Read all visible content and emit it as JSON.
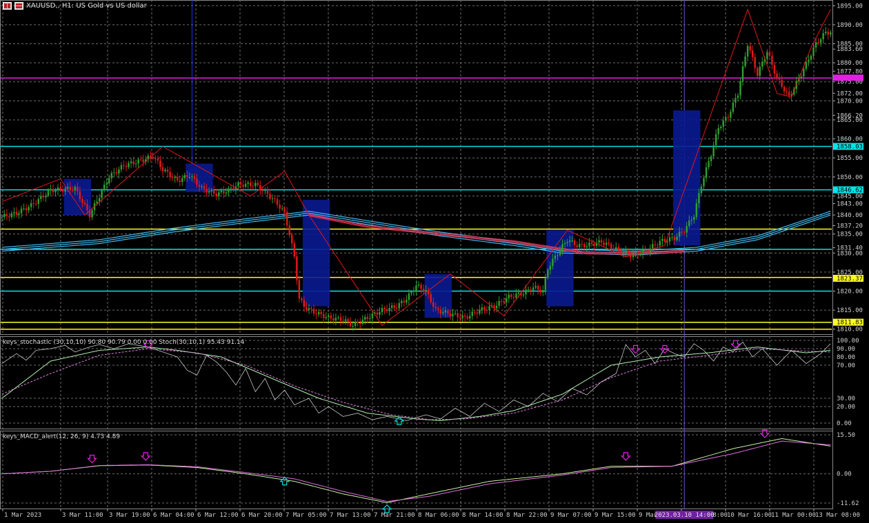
{
  "window": {
    "title": "XAUUSD,, H1:  US Gold vs US dollar"
  },
  "panes": {
    "stoch_label": "keys_stochastic (30,10,10) 90.80 90.79 0.00 0.00 Stoch(30,10,1) 95.43 91.14",
    "macd_label": "keys_MACD_alert(12, 26, 9) 4.73 4.89"
  },
  "colors": {
    "background": "#000000",
    "grid": "#6e6e6e",
    "bull": "#2e9e2e",
    "bear": "#e01818",
    "box": "#0a1a90",
    "zigzag": "#e01818",
    "ma_blue": "#40b8f0",
    "ma_red": "#e03050",
    "cyan_line": "#00e5e5",
    "yellow_line": "#ffff20",
    "magenta_line": "#e020e0",
    "vline_blue": "#2030ff",
    "vline_violet": "#7050d0"
  },
  "chart_data": [
    {
      "type": "candlestick",
      "symbol": "XAUUSD",
      "timeframe": "H1",
      "y_axis_labels": [
        "1895.00",
        "1890.00",
        "1885.00",
        "1883.60",
        "1880.00",
        "1877.80",
        "1875.00",
        "1872.00",
        "1870.00",
        "1866.20",
        "1865.00",
        "1860.00",
        "1858.03",
        "1855.00",
        "1850.00",
        "1846.62",
        "1845.00",
        "1843.00",
        "1840.00",
        "1837.20",
        "1835.00",
        "1831.40",
        "1830.00",
        "1825.00",
        "1823.37",
        "1820.00",
        "1815.00",
        "1811.83",
        "1810.00"
      ],
      "y_range": [
        1808.5,
        1896.5
      ],
      "x_tick_labels": [
        "1 Mar 2023",
        "3 Mar 11:00",
        "3 Mar 19:00",
        "6 Mar 04:00",
        "6 Mar 12:00",
        "6 Mar 20:00",
        "7 Mar 05:00",
        "7 Mar 13:00",
        "7 Mar 21:00",
        "8 Mar 06:00",
        "8 Mar 14:00",
        "8 Mar 22:00",
        "9 Mar 07:00",
        "9 Mar 15:00",
        "9 Mar 23:00",
        "10 Mar 08:00",
        "10 Mar 16:00",
        "11 Mar 00:00",
        "13 Mar 08:00"
      ],
      "crosshair_time_label": "2023.03.10 14:00",
      "anchors": [
        [
          0,
          1839.5
        ],
        [
          6,
          1840.5
        ],
        [
          12,
          1842.5
        ],
        [
          20,
          1846.5
        ],
        [
          30,
          1847
        ],
        [
          36,
          1840
        ],
        [
          44,
          1850
        ],
        [
          50,
          1853
        ],
        [
          58,
          1854.5
        ],
        [
          62,
          1855.5
        ],
        [
          66,
          1852
        ],
        [
          72,
          1849
        ],
        [
          77,
          1850.5
        ],
        [
          82,
          1847
        ],
        [
          88,
          1845.5
        ],
        [
          93,
          1846.5
        ],
        [
          97,
          1848
        ],
        [
          104,
          1848
        ],
        [
          109,
          1845.5
        ],
        [
          113,
          1843
        ],
        [
          116,
          1840.5
        ],
        [
          118,
          1835
        ],
        [
          120,
          1829
        ],
        [
          122,
          1818
        ],
        [
          124,
          1816
        ],
        [
          128,
          1814.5
        ],
        [
          134,
          1813
        ],
        [
          140,
          1812.5
        ],
        [
          144,
          1811
        ],
        [
          150,
          1813
        ],
        [
          156,
          1815
        ],
        [
          162,
          1816
        ],
        [
          166,
          1818
        ],
        [
          170,
          1821.5
        ],
        [
          174,
          1820
        ],
        [
          178,
          1815
        ],
        [
          184,
          1814
        ],
        [
          190,
          1813
        ],
        [
          196,
          1815
        ],
        [
          202,
          1816
        ],
        [
          208,
          1818.5
        ],
        [
          214,
          1819.5
        ],
        [
          218,
          1821
        ],
        [
          222,
          1820
        ],
        [
          224,
          1826
        ],
        [
          228,
          1830
        ],
        [
          232,
          1833.5
        ],
        [
          236,
          1832
        ],
        [
          240,
          1832
        ],
        [
          246,
          1833
        ],
        [
          252,
          1831
        ],
        [
          258,
          1829.5
        ],
        [
          264,
          1830.5
        ],
        [
          270,
          1833
        ],
        [
          276,
          1834
        ],
        [
          280,
          1836
        ],
        [
          284,
          1840
        ],
        [
          287,
          1848
        ],
        [
          291,
          1856
        ],
        [
          294,
          1863
        ],
        [
          298,
          1866
        ],
        [
          302,
          1872
        ],
        [
          306,
          1885
        ],
        [
          310,
          1877
        ],
        [
          314,
          1883
        ],
        [
          318,
          1876
        ],
        [
          323,
          1871
        ],
        [
          328,
          1877
        ],
        [
          334,
          1885
        ],
        [
          338,
          1888
        ]
      ],
      "blue_boxes": [
        {
          "from": 26,
          "to": 36,
          "low": 1840,
          "high": 1849.5
        },
        {
          "from": 76,
          "to": 86,
          "low": 1846,
          "high": 1853.5
        },
        {
          "from": 124,
          "to": 134,
          "low": 1816,
          "high": 1844
        },
        {
          "from": 174,
          "to": 184,
          "low": 1813,
          "high": 1824.5
        },
        {
          "from": 224,
          "to": 234,
          "low": 1816,
          "high": 1836
        },
        {
          "from": 276,
          "to": 286,
          "low": 1832,
          "high": 1867.5
        }
      ],
      "zigzag": [
        [
          0,
          1843.5
        ],
        [
          24,
          1849.5
        ],
        [
          34,
          1840
        ],
        [
          66,
          1858
        ],
        [
          102,
          1845
        ],
        [
          116,
          1851.5
        ],
        [
          126,
          1840
        ],
        [
          156,
          1811
        ],
        [
          184,
          1824.5
        ],
        [
          206,
          1813.5
        ],
        [
          232,
          1836
        ],
        [
          256,
          1829
        ],
        [
          272,
          1832
        ],
        [
          306,
          1894
        ],
        [
          318,
          1872
        ],
        [
          324,
          1871
        ],
        [
          332,
          1884
        ],
        [
          340,
          1894
        ]
      ],
      "ma_blue": [
        [
          0,
          1831
        ],
        [
          40,
          1833
        ],
        [
          70,
          1836
        ],
        [
          100,
          1838.5
        ],
        [
          126,
          1840.5
        ],
        [
          150,
          1838
        ],
        [
          180,
          1835
        ],
        [
          210,
          1832.5
        ],
        [
          230,
          1830.5
        ],
        [
          260,
          1830
        ],
        [
          285,
          1831
        ],
        [
          310,
          1834
        ],
        [
          340,
          1840.5
        ]
      ],
      "ma_red": [
        [
          126,
          1840
        ],
        [
          150,
          1837
        ],
        [
          180,
          1835
        ],
        [
          210,
          1833
        ],
        [
          240,
          1830
        ],
        [
          260,
          1830
        ],
        [
          280,
          1830.5
        ]
      ],
      "horizontal_lines": [
        {
          "price": 1876,
          "color": "magenta"
        },
        {
          "price": 1858.03,
          "color": "cyan"
        },
        {
          "price": 1846.62,
          "color": "cyan"
        },
        {
          "price": 1831,
          "color": "cyan"
        },
        {
          "price": 1820,
          "color": "cyan"
        },
        {
          "price": 1836.3,
          "color": "yellow"
        },
        {
          "price": 1823.6,
          "color": "yellow"
        },
        {
          "price": 1811.8,
          "color": "yellow"
        },
        {
          "price": 1810,
          "color": "yellow"
        }
      ],
      "price_tags": [
        {
          "label": "1858.03",
          "price": 1858.03,
          "color": "cyan"
        },
        {
          "label": "1846.62",
          "price": 1846.62,
          "color": "cyan"
        },
        {
          "label": "1823.37",
          "price": 1823.37,
          "color": "yellow"
        },
        {
          "label": "1811.83",
          "price": 1811.83,
          "color": "yellow"
        }
      ],
      "vertical_lines": [
        {
          "index": 78,
          "color": "blue"
        },
        {
          "index": 280,
          "color": "violet"
        }
      ]
    },
    {
      "type": "line",
      "name": "keys_stochastic",
      "y_axis_labels": [
        "100.00",
        "90.00",
        "80.00",
        "70.00",
        "30.00",
        "20.00",
        "0.00"
      ],
      "y_range": [
        0,
        100
      ],
      "main": [
        [
          0,
          30
        ],
        [
          20,
          75
        ],
        [
          40,
          88
        ],
        [
          60,
          92
        ],
        [
          72,
          88
        ],
        [
          90,
          80
        ],
        [
          110,
          55
        ],
        [
          130,
          30
        ],
        [
          150,
          12
        ],
        [
          170,
          5
        ],
        [
          180,
          3
        ],
        [
          196,
          8
        ],
        [
          210,
          15
        ],
        [
          230,
          35
        ],
        [
          250,
          70
        ],
        [
          270,
          80
        ],
        [
          290,
          85
        ],
        [
          310,
          92
        ],
        [
          330,
          85
        ],
        [
          340,
          88
        ]
      ],
      "signal": [
        [
          0,
          35
        ],
        [
          20,
          60
        ],
        [
          40,
          82
        ],
        [
          60,
          90
        ],
        [
          80,
          85
        ],
        [
          100,
          70
        ],
        [
          120,
          45
        ],
        [
          140,
          25
        ],
        [
          160,
          10
        ],
        [
          176,
          4
        ],
        [
          190,
          5
        ],
        [
          210,
          12
        ],
        [
          230,
          28
        ],
        [
          250,
          55
        ],
        [
          270,
          75
        ],
        [
          290,
          82
        ],
        [
          310,
          90
        ],
        [
          330,
          87
        ],
        [
          340,
          86
        ]
      ],
      "raw": [
        [
          0,
          72
        ],
        [
          6,
          84
        ],
        [
          10,
          76
        ],
        [
          14,
          88
        ],
        [
          20,
          90
        ],
        [
          26,
          94
        ],
        [
          30,
          86
        ],
        [
          36,
          92
        ],
        [
          40,
          95
        ],
        [
          46,
          90
        ],
        [
          52,
          96
        ],
        [
          60,
          92
        ],
        [
          66,
          86
        ],
        [
          72,
          80
        ],
        [
          76,
          64
        ],
        [
          80,
          58
        ],
        [
          84,
          82
        ],
        [
          88,
          74
        ],
        [
          92,
          62
        ],
        [
          96,
          46
        ],
        [
          100,
          66
        ],
        [
          104,
          38
        ],
        [
          108,
          54
        ],
        [
          112,
          28
        ],
        [
          116,
          40
        ],
        [
          120,
          22
        ],
        [
          126,
          30
        ],
        [
          130,
          12
        ],
        [
          134,
          20
        ],
        [
          140,
          8
        ],
        [
          146,
          12
        ],
        [
          152,
          4
        ],
        [
          158,
          8
        ],
        [
          166,
          3
        ],
        [
          174,
          10
        ],
        [
          180,
          5
        ],
        [
          186,
          18
        ],
        [
          192,
          8
        ],
        [
          198,
          24
        ],
        [
          204,
          14
        ],
        [
          210,
          28
        ],
        [
          216,
          20
        ],
        [
          222,
          36
        ],
        [
          228,
          26
        ],
        [
          234,
          42
        ],
        [
          240,
          34
        ],
        [
          246,
          50
        ],
        [
          252,
          60
        ],
        [
          256,
          95
        ],
        [
          260,
          80
        ],
        [
          264,
          88
        ],
        [
          268,
          72
        ],
        [
          272,
          90
        ],
        [
          276,
          84
        ],
        [
          280,
          80
        ],
        [
          284,
          96
        ],
        [
          288,
          88
        ],
        [
          292,
          75
        ],
        [
          296,
          92
        ],
        [
          300,
          86
        ],
        [
          304,
          98
        ],
        [
          308,
          80
        ],
        [
          312,
          90
        ],
        [
          318,
          70
        ],
        [
          324,
          88
        ],
        [
          330,
          72
        ],
        [
          336,
          84
        ],
        [
          340,
          96
        ]
      ],
      "arrows": [
        {
          "index": 60,
          "value": 94,
          "dir": "down",
          "color": "magenta"
        },
        {
          "index": 163,
          "value": 4,
          "dir": "up",
          "color": "cyan"
        },
        {
          "index": 260,
          "value": 88,
          "dir": "down",
          "color": "magenta"
        },
        {
          "index": 272,
          "value": 88,
          "dir": "down",
          "color": "magenta"
        },
        {
          "index": 301,
          "value": 94,
          "dir": "down",
          "color": "magenta"
        }
      ]
    },
    {
      "type": "line",
      "name": "keys_MACD_alert",
      "y_axis_labels": [
        "15.50",
        "0.00",
        "-11.62"
      ],
      "y_range": [
        -11.62,
        15.5
      ],
      "main": [
        [
          0,
          0
        ],
        [
          20,
          1
        ],
        [
          40,
          3.2
        ],
        [
          60,
          3.5
        ],
        [
          80,
          2.5
        ],
        [
          100,
          0
        ],
        [
          120,
          -3
        ],
        [
          140,
          -8
        ],
        [
          158,
          -11.5
        ],
        [
          175,
          -8
        ],
        [
          200,
          -3
        ],
        [
          230,
          0
        ],
        [
          250,
          3
        ],
        [
          275,
          3
        ],
        [
          300,
          10
        ],
        [
          320,
          14
        ],
        [
          340,
          11
        ]
      ],
      "signal": [
        [
          0,
          0
        ],
        [
          20,
          1
        ],
        [
          40,
          3.3
        ],
        [
          60,
          3.6
        ],
        [
          80,
          2.8
        ],
        [
          100,
          0.5
        ],
        [
          120,
          -2
        ],
        [
          140,
          -7
        ],
        [
          158,
          -11
        ],
        [
          175,
          -9
        ],
        [
          200,
          -4
        ],
        [
          230,
          -0.5
        ],
        [
          250,
          2.5
        ],
        [
          275,
          3
        ],
        [
          300,
          8
        ],
        [
          320,
          13
        ],
        [
          340,
          11.5
        ]
      ],
      "arrows": [
        {
          "index": 37,
          "value": 5.5,
          "dir": "down",
          "color": "magenta"
        },
        {
          "index": 59,
          "value": 6.5,
          "dir": "down",
          "color": "magenta"
        },
        {
          "index": 116,
          "value": -2.5,
          "dir": "up",
          "color": "cyan"
        },
        {
          "index": 158,
          "value": -13.5,
          "dir": "up",
          "color": "cyan"
        },
        {
          "index": 256,
          "value": 6.5,
          "dir": "down",
          "color": "magenta"
        },
        {
          "index": 313,
          "value": 15.5,
          "dir": "down",
          "color": "magenta"
        }
      ]
    }
  ]
}
